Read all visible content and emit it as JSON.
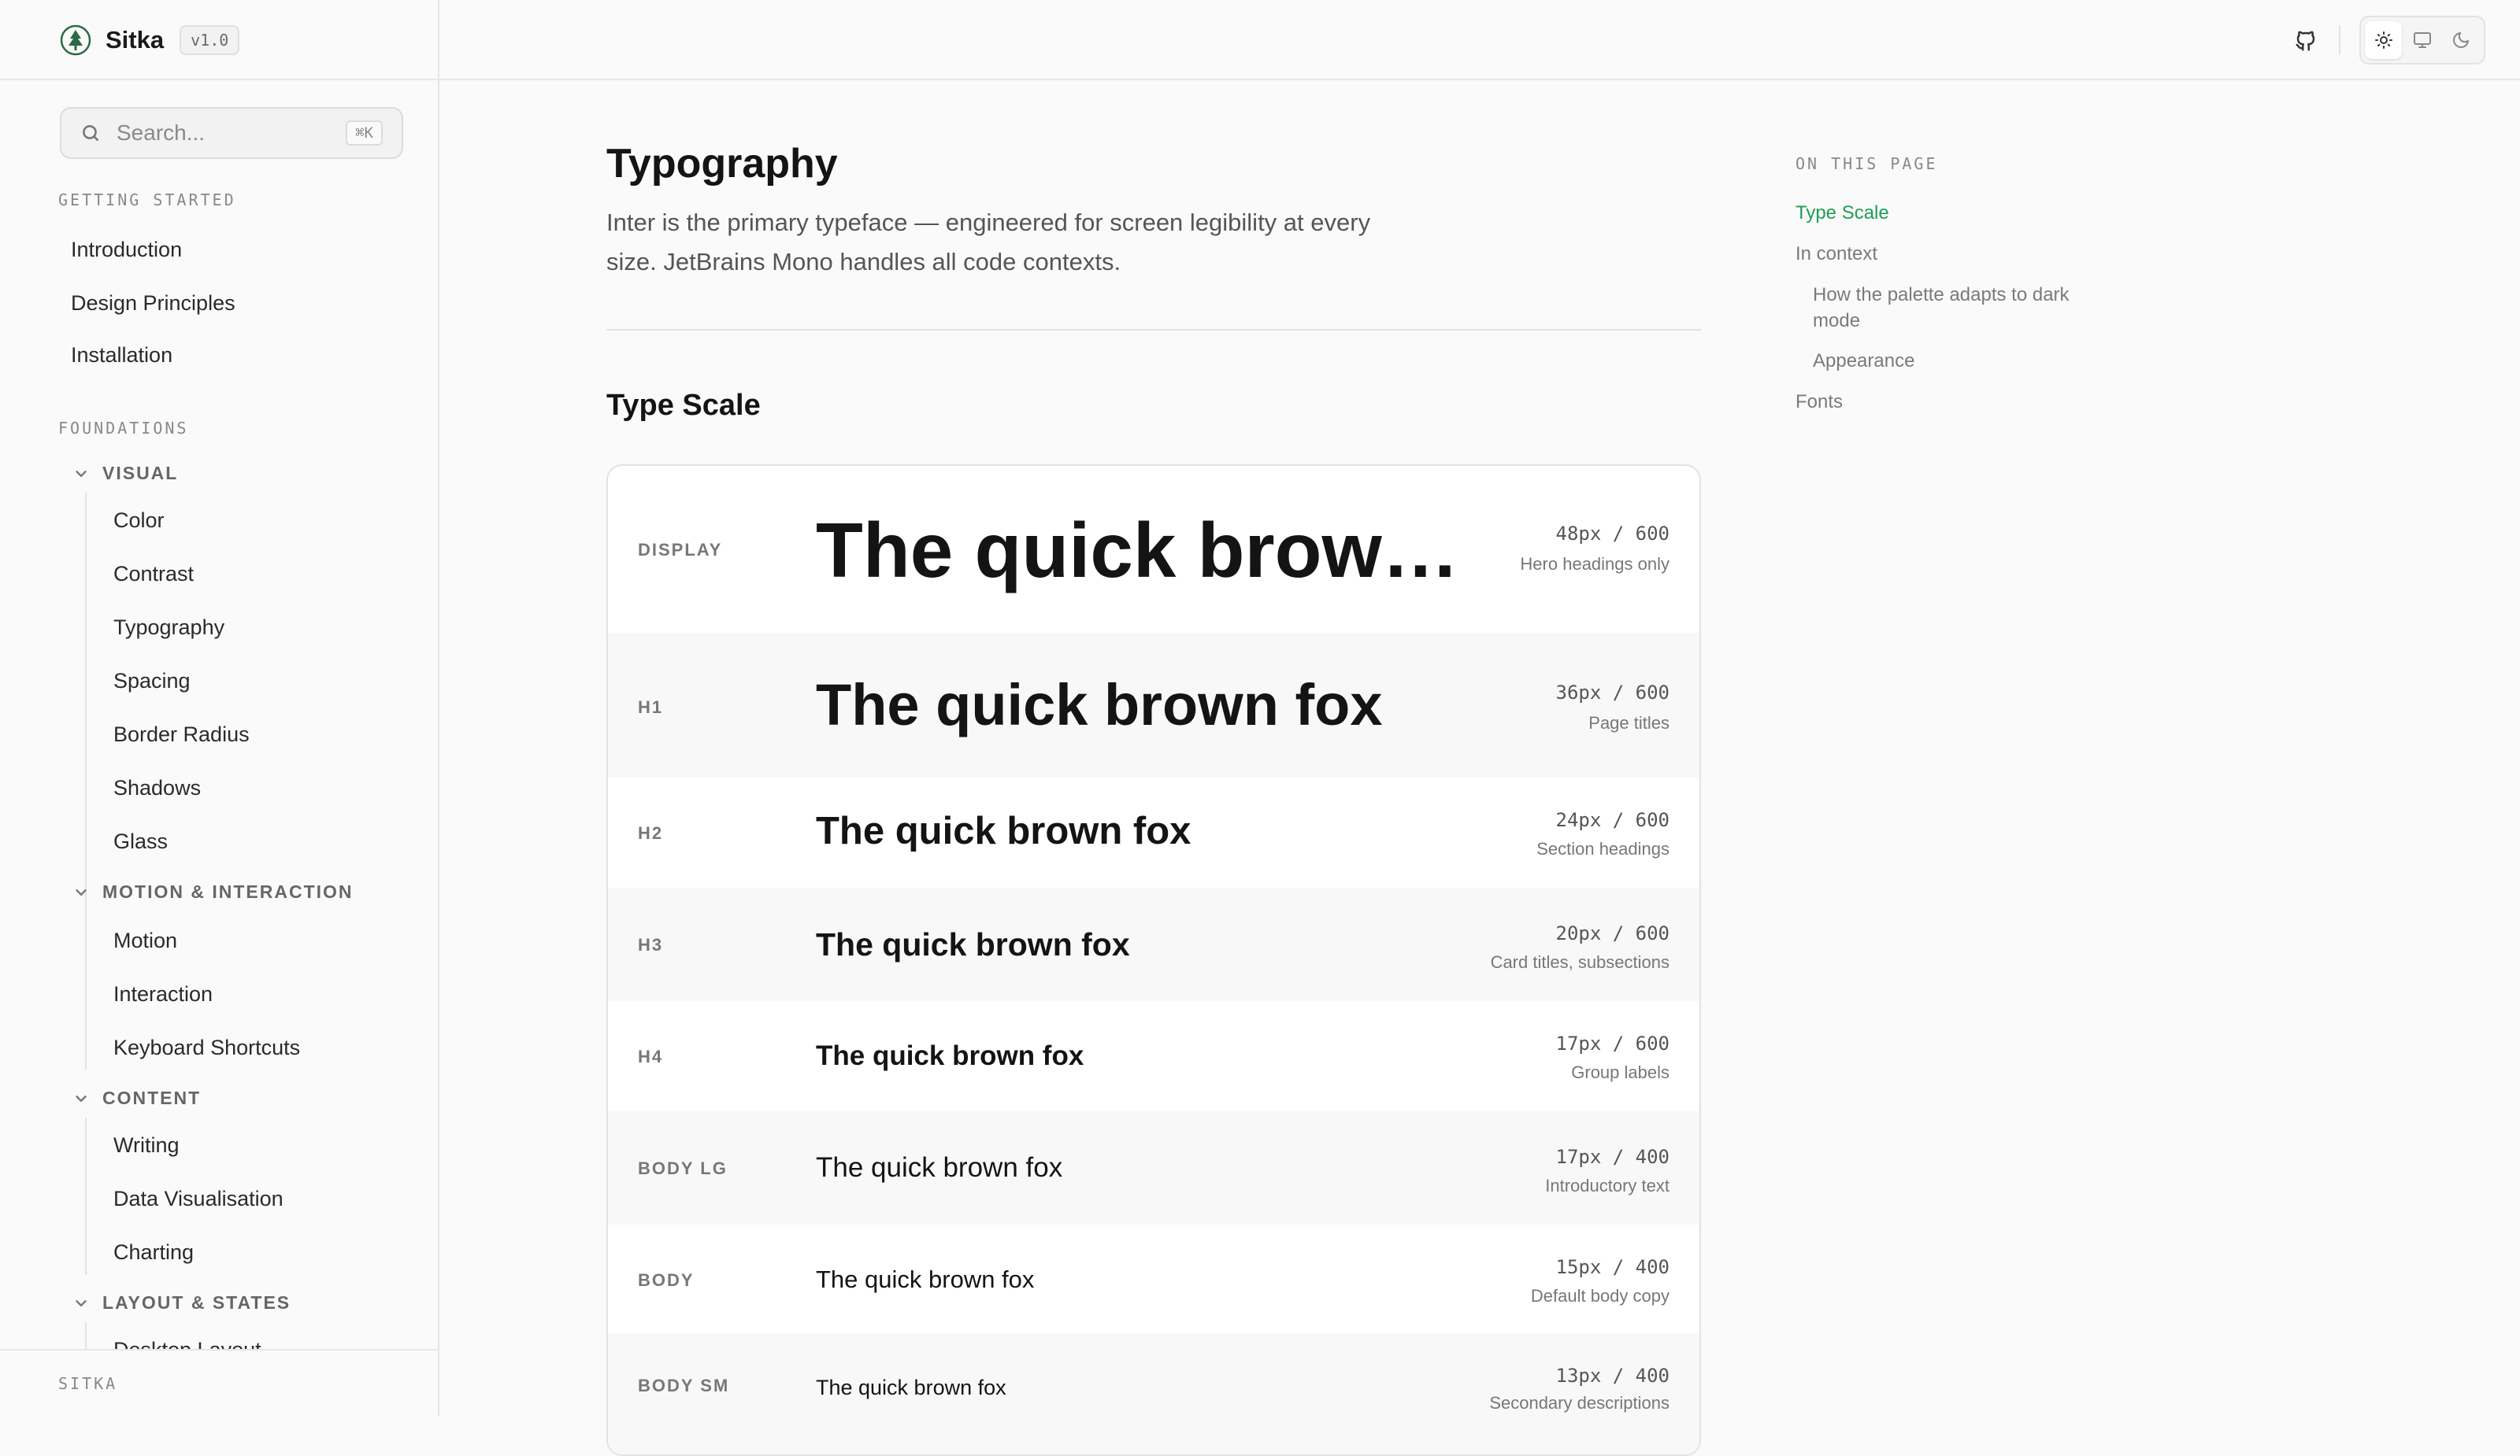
{
  "brand": {
    "name": "Sitka",
    "version": "v1.0"
  },
  "header": {
    "icons": [
      "github-icon",
      "sun-icon",
      "monitor-icon",
      "moon-icon"
    ],
    "theme_active": "light"
  },
  "search": {
    "placeholder": "Search...",
    "shortcut": "⌘K"
  },
  "sidebar": {
    "getting_started": {
      "label": "GETTING STARTED",
      "items": [
        "Introduction",
        "Design Principles",
        "Installation"
      ]
    },
    "foundations": {
      "label": "FOUNDATIONS",
      "groups": [
        {
          "label": "VISUAL",
          "items": [
            "Color",
            "Contrast",
            "Typography",
            "Spacing",
            "Border Radius",
            "Shadows",
            "Glass"
          ]
        },
        {
          "label": "MOTION & INTERACTION",
          "items": [
            "Motion",
            "Interaction",
            "Keyboard Shortcuts"
          ]
        },
        {
          "label": "CONTENT",
          "items": [
            "Writing",
            "Data Visualisation",
            "Charting"
          ]
        },
        {
          "label": "LAYOUT & STATES",
          "items": [
            "Desktop Layout"
          ]
        }
      ]
    },
    "footer": "SITKA"
  },
  "main": {
    "title": "Typography",
    "lead": "Inter is the primary typeface — engineered for screen legibility at every size. JetBrains Mono handles all code contexts.",
    "section_title": "Type Scale",
    "rows": [
      {
        "label": "DISPLAY",
        "sample": "The quick brown fox",
        "spec": "48px / 600",
        "desc": "Hero headings only"
      },
      {
        "label": "H1",
        "sample": "The quick brown fox",
        "spec": "36px / 600",
        "desc": "Page titles"
      },
      {
        "label": "H2",
        "sample": "The quick brown fox",
        "spec": "24px / 600",
        "desc": "Section headings"
      },
      {
        "label": "H3",
        "sample": "The quick brown fox",
        "spec": "20px / 600",
        "desc": "Card titles, subsections"
      },
      {
        "label": "H4",
        "sample": "The quick brown fox",
        "spec": "17px / 600",
        "desc": "Group labels"
      },
      {
        "label": "BODY LG",
        "sample": "The quick brown fox",
        "spec": "17px / 400",
        "desc": "Introductory text"
      },
      {
        "label": "BODY",
        "sample": "The quick brown fox",
        "spec": "15px / 400",
        "desc": "Default body copy"
      },
      {
        "label": "BODY SM",
        "sample": "The quick brown fox",
        "spec": "13px / 400",
        "desc": "Secondary descriptions"
      }
    ]
  },
  "toc": {
    "title": "ON THIS PAGE",
    "items": [
      "Type Scale",
      "In context",
      "How the palette adapts to dark mode",
      "Appearance",
      "Fonts"
    ],
    "active": "Type Scale",
    "accent_color": "#1f9d55"
  }
}
